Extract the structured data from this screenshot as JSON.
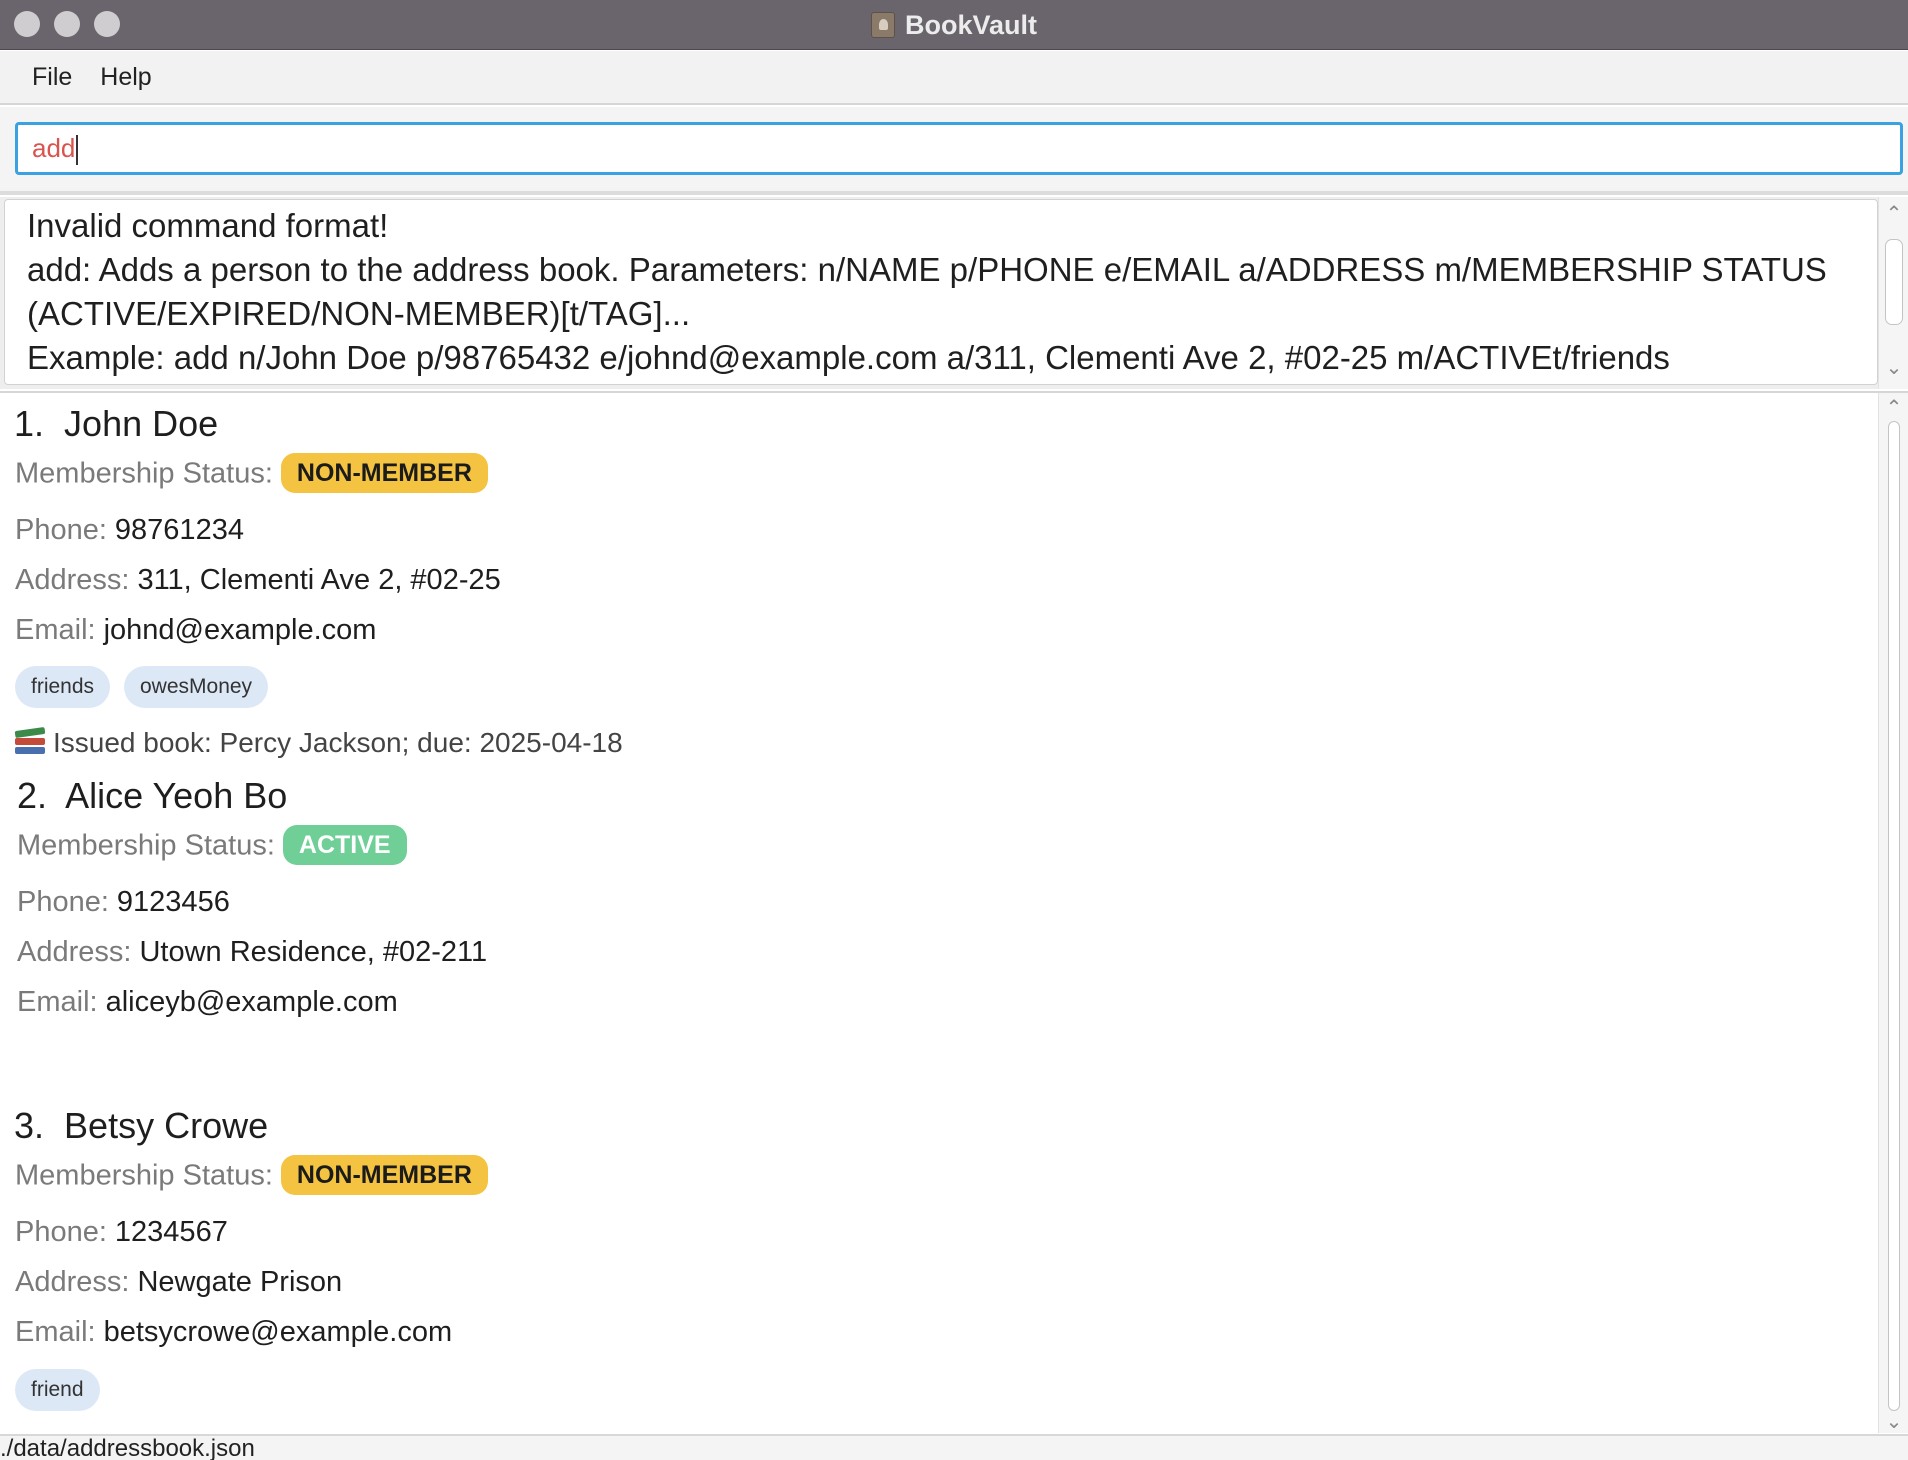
{
  "window": {
    "title": "BookVault"
  },
  "menu": {
    "file": "File",
    "help": "Help"
  },
  "command": {
    "value": "add"
  },
  "result": {
    "lines": [
      "Invalid command format!",
      "add: Adds a person to the address book. Parameters: n/NAME p/PHONE e/EMAIL a/ADDRESS m/MEMBERSHIP STATUS",
      "(ACTIVE/EXPIRED/NON-MEMBER)[t/TAG]...",
      "Example: add n/John Doe p/98765432 e/johnd@example.com a/311, Clementi Ave 2, #02-25 m/ACTIVEt/friends"
    ]
  },
  "labels": {
    "membership": "Membership Status:",
    "phone": "Phone:",
    "address": "Address:",
    "email": "Email:"
  },
  "persons": [
    {
      "index": "1.",
      "name": "John Doe",
      "status": "NON-MEMBER",
      "phone": "98761234",
      "address": "311, Clementi Ave 2, #02-25",
      "email": "johnd@example.com",
      "tags": [
        "friends",
        "owesMoney"
      ],
      "issued": "Issued book: Percy Jackson; due: 2025-04-18"
    },
    {
      "index": "2.",
      "name": "Alice Yeoh Bo",
      "status": "ACTIVE",
      "phone": "9123456",
      "address": "Utown Residence, #02-211",
      "email": "aliceyb@example.com",
      "tags": []
    },
    {
      "index": "3.",
      "name": "Betsy Crowe",
      "status": "NON-MEMBER",
      "phone": "1234567",
      "address": "Newgate Prison",
      "email": "betsycrowe@example.com",
      "tags": [
        "friend"
      ]
    }
  ],
  "status_colors": {
    "non_member": "#f3c341",
    "active": "#6fcf97",
    "accent": "#3aa2e0",
    "command_text": "#d9534f"
  },
  "statusbar": {
    "path": "./data/addressbook.json"
  }
}
